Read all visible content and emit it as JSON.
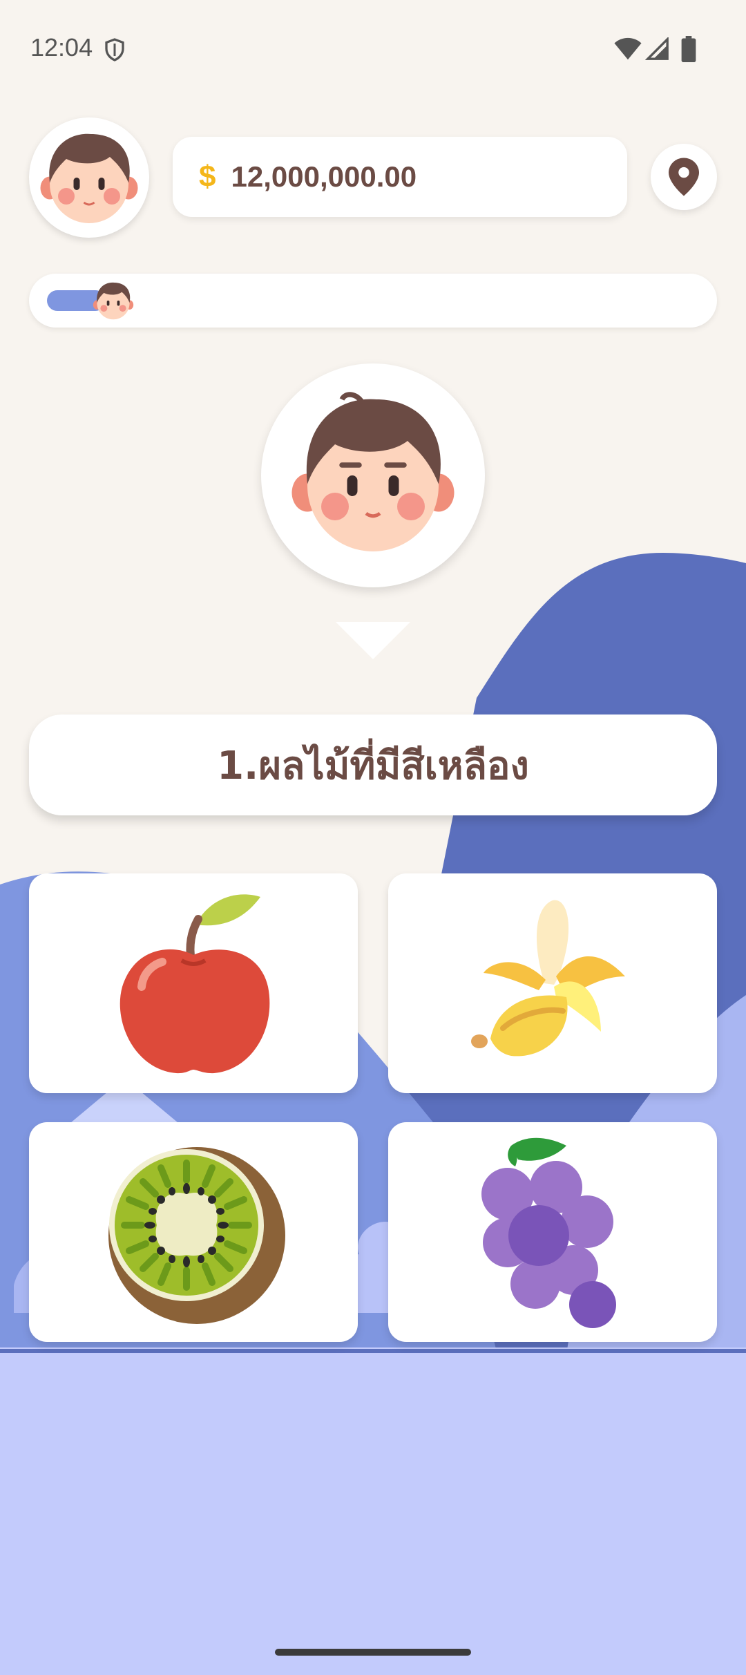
{
  "status_bar": {
    "time": "12:04"
  },
  "wallet": {
    "currency_symbol": "$",
    "balance": "12,000,000.00"
  },
  "progress": {
    "fraction": 0.09
  },
  "question": {
    "text": "1.ผลไม้ที่มีสีเหลือง"
  },
  "choices": [
    {
      "id": "apple",
      "icon": "apple-icon"
    },
    {
      "id": "banana",
      "icon": "banana-icon"
    },
    {
      "id": "kiwi",
      "icon": "kiwi-icon"
    },
    {
      "id": "grapes",
      "icon": "grapes-icon"
    }
  ],
  "colors": {
    "background": "#f8f4ef",
    "hill_dark": "#5b6fbd",
    "hill_mid": "#7f96e0",
    "ground": "#c3cbfc",
    "text_brown": "#6b4b44",
    "coin_gold": "#f4b61a"
  }
}
